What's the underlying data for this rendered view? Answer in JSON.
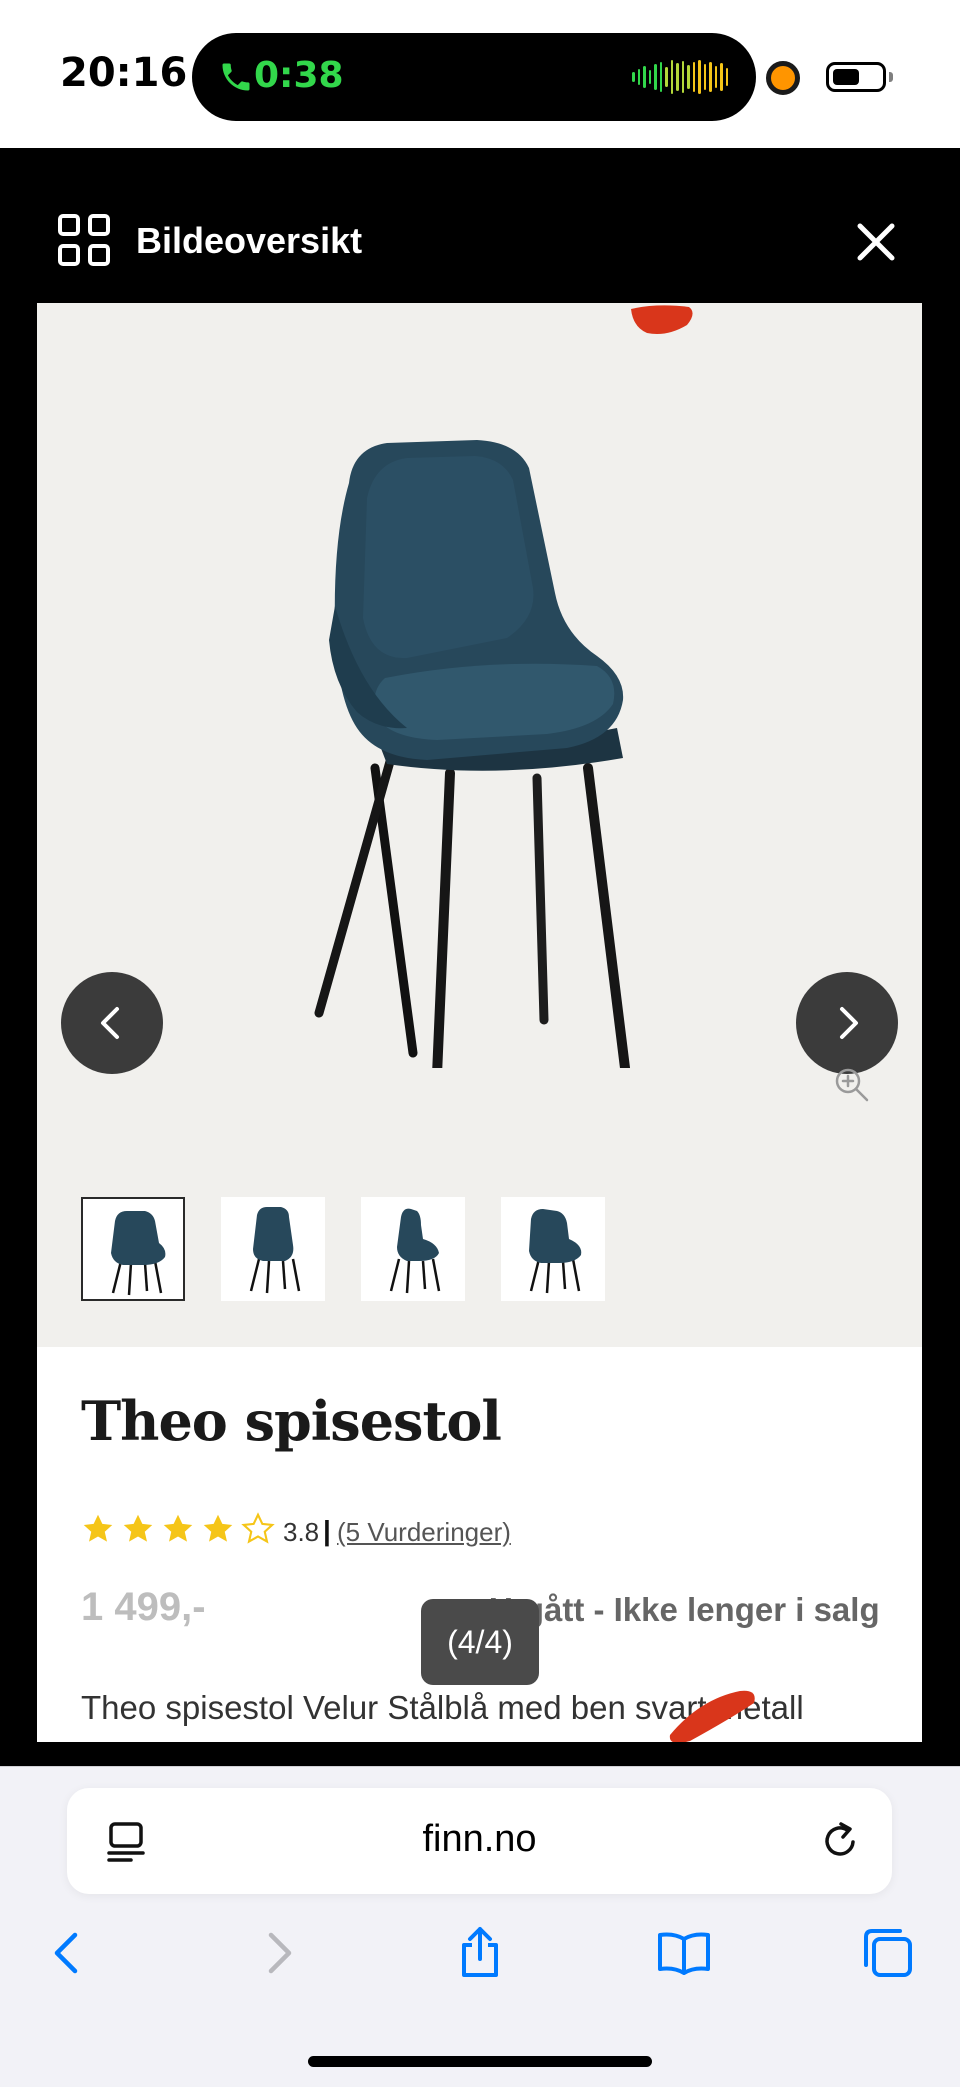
{
  "status_bar": {
    "time": "20:16",
    "call_duration": "0:38",
    "battery_level": 0.55
  },
  "overlay": {
    "title": "Bildeoversikt",
    "grid_icon": "grid-icon",
    "close_icon": "close-icon"
  },
  "gallery": {
    "counter": "(4/4)",
    "thumbnails_count": 4,
    "active_thumbnail": 1,
    "prev_icon": "chevron-left-icon",
    "next_icon": "chevron-right-icon",
    "zoom_icon": "zoom-in-icon"
  },
  "product": {
    "title": "Theo spisestol",
    "rating": 3.8,
    "rating_text": "3.8",
    "rating_separator": "|",
    "reviews_link": "(5 Vurderinger)",
    "price": "1 499,-",
    "status": "Utgått - Ikke lenger i salg",
    "description": "Theo spisestol Velur Stålblå med ben svart metall"
  },
  "browser": {
    "url": "finn.no",
    "icons": [
      "reader-icon",
      "reload-icon",
      "back-icon",
      "forward-icon",
      "share-icon",
      "bookmarks-icon",
      "tabs-icon"
    ]
  },
  "colors": {
    "star": "#f5c518",
    "chair": "#27485b",
    "accent_blue": "#007aff",
    "call_green": "#32d74b"
  }
}
